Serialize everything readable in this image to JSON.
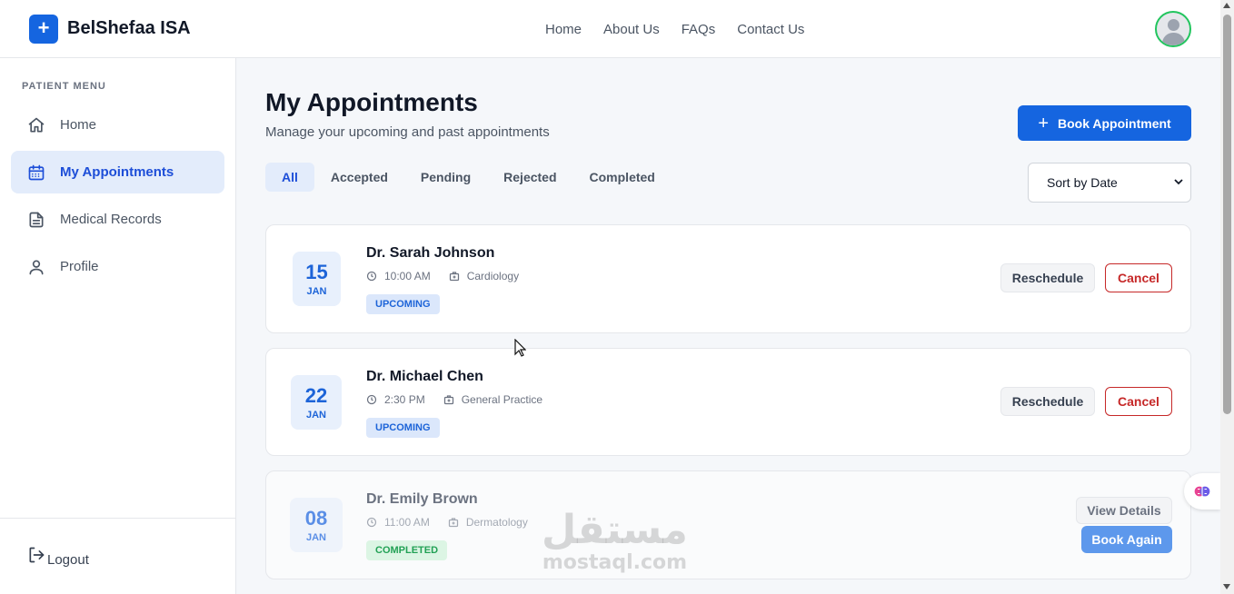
{
  "app": {
    "logo_symbol": "+",
    "name": "BelShefaa ISA"
  },
  "nav": {
    "items": [
      "Home",
      "About Us",
      "FAQs",
      "Contact Us"
    ]
  },
  "sidebar": {
    "title": "PATIENT MENU",
    "items": [
      {
        "label": "Home",
        "icon": "home-icon"
      },
      {
        "label": "My Appointments",
        "icon": "calendar-icon",
        "active": true
      },
      {
        "label": "Medical Records",
        "icon": "document-icon"
      },
      {
        "label": "Profile",
        "icon": "user-icon"
      }
    ],
    "logout": "Logout"
  },
  "main": {
    "title": "My Appointments",
    "subtitle": "Manage your upcoming and past appointments",
    "book_button": "Book Appointment",
    "tabs": [
      "All",
      "Accepted",
      "Pending",
      "Rejected",
      "Completed"
    ],
    "active_tab": "All",
    "sort": {
      "selected": "Sort by Date"
    }
  },
  "appointments": [
    {
      "day": "15",
      "month": "JAN",
      "doctor": "Dr. Sarah Johnson",
      "time": "10:00 AM",
      "specialty": "Cardiology",
      "status": "UPCOMING",
      "actions": [
        "Reschedule",
        "Cancel"
      ]
    },
    {
      "day": "22",
      "month": "JAN",
      "doctor": "Dr. Michael Chen",
      "time": "2:30 PM",
      "specialty": "General Practice",
      "status": "UPCOMING",
      "actions": [
        "Reschedule",
        "Cancel"
      ]
    },
    {
      "day": "08",
      "month": "JAN",
      "doctor": "Dr. Emily Brown",
      "time": "11:00 AM",
      "specialty": "Dermatology",
      "status": "COMPLETED",
      "actions": [
        "View Details",
        "Book Again"
      ]
    }
  ],
  "watermark": {
    "arabic": "مستقل",
    "latin": "mostaql.com"
  },
  "colors": {
    "primary": "#1565e0",
    "cancel": "#c62828",
    "completed": "#22a155",
    "avatar_ring": "#22c55e"
  }
}
